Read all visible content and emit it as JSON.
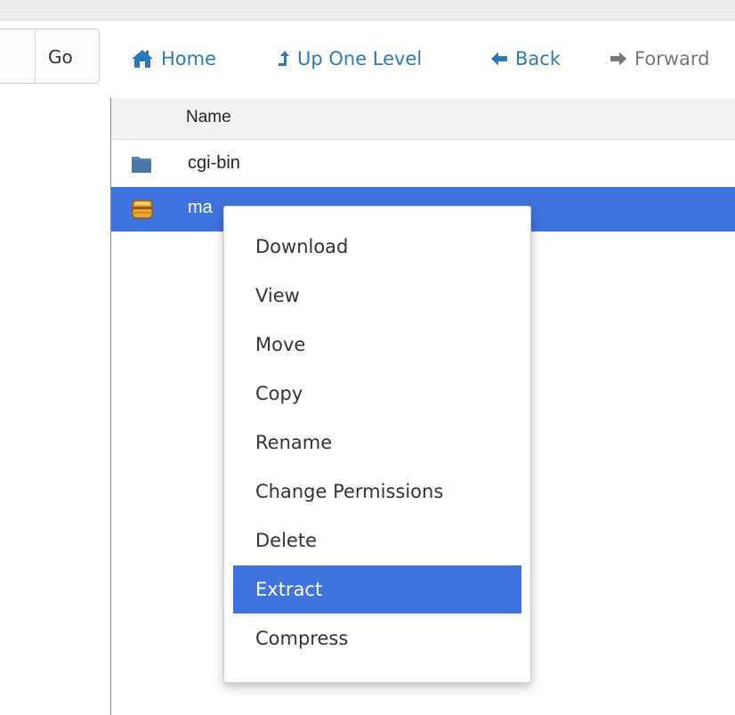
{
  "toolbar": {
    "go_label": "Go",
    "home_label": "Home",
    "up_label": "Up One Level",
    "back_label": "Back",
    "forward_label": "Forward"
  },
  "file_list": {
    "header_name": "Name",
    "rows": [
      {
        "name": "cgi-bin",
        "icon": "folder-icon",
        "selected": false
      },
      {
        "name": "ma",
        "icon": "archive-icon",
        "selected": true
      }
    ]
  },
  "context_menu": {
    "items": [
      {
        "label": "Download",
        "highlighted": false
      },
      {
        "label": "View",
        "highlighted": false
      },
      {
        "label": "Move",
        "highlighted": false
      },
      {
        "label": "Copy",
        "highlighted": false
      },
      {
        "label": "Rename",
        "highlighted": false
      },
      {
        "label": "Change Permissions",
        "highlighted": false
      },
      {
        "label": "Delete",
        "highlighted": false
      },
      {
        "label": "Extract",
        "highlighted": true
      },
      {
        "label": "Compress",
        "highlighted": false
      }
    ]
  },
  "colors": {
    "link": "#2a7ab8",
    "selection": "#3f74de",
    "disabled_nav": "#777777"
  }
}
